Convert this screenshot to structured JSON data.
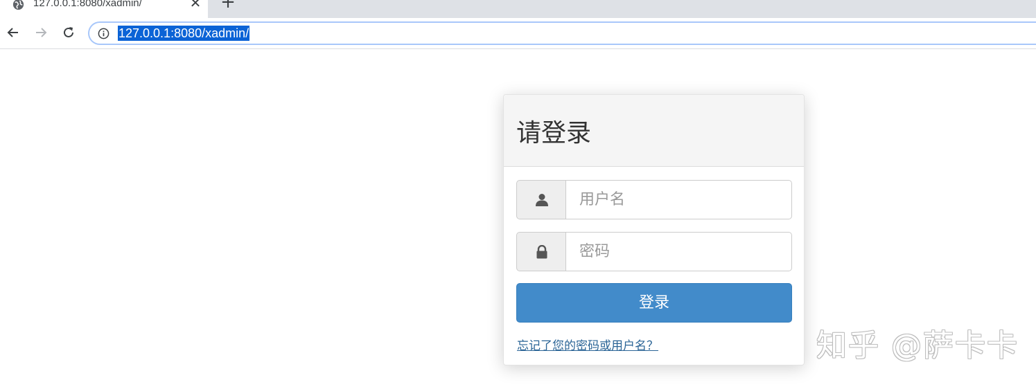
{
  "browser": {
    "tab": {
      "title": "127.0.0.1:8080/xadmin/",
      "favicon": "globe-icon",
      "close_symbol": "✕"
    },
    "new_tab_symbol": "+",
    "nav": {
      "back_icon": "arrow-left-icon",
      "forward_icon": "arrow-right-icon",
      "reload_icon": "reload-icon"
    },
    "address_bar": {
      "info_icon": "info-icon",
      "url": "127.0.0.1:8080/xadmin/",
      "selected": true,
      "selection_color": "#0b63d6"
    }
  },
  "login": {
    "title": "请登录",
    "username": {
      "icon": "user-icon",
      "placeholder": "用户名",
      "value": ""
    },
    "password": {
      "icon": "lock-icon",
      "placeholder": "密码",
      "value": ""
    },
    "submit_label": "登录",
    "forgot_link": "忘记了您的密码或用户名？",
    "colors": {
      "primary": "#428bca",
      "link": "#2a6496"
    }
  },
  "watermark": "知乎 @萨卡卡"
}
